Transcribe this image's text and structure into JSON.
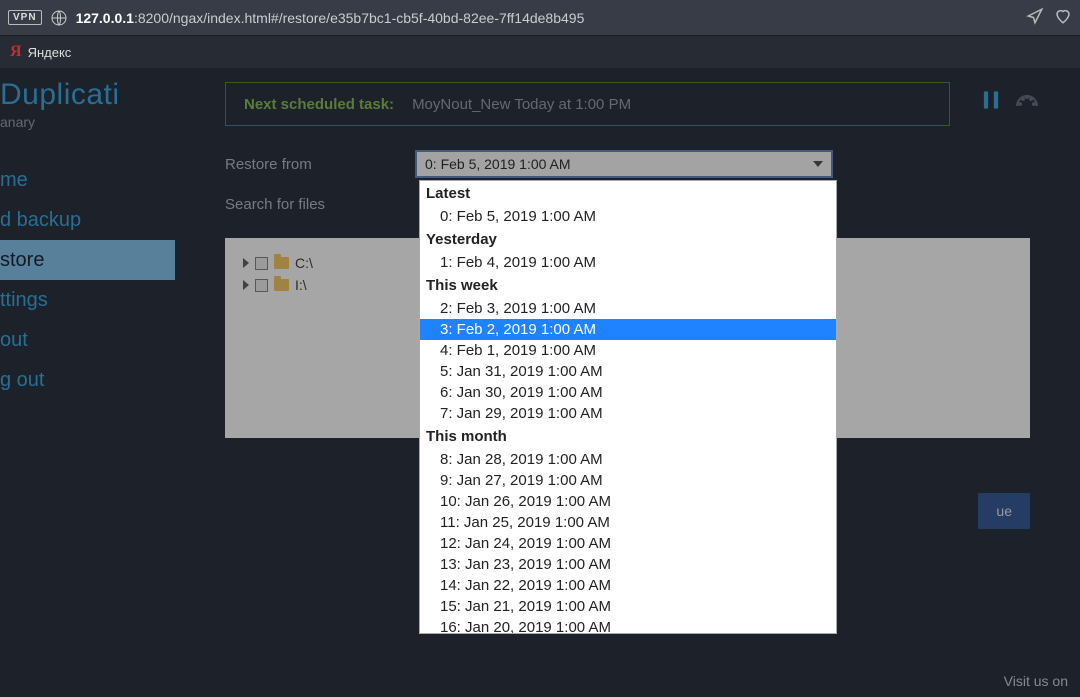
{
  "browser": {
    "vpn_badge": "VPN",
    "host": "127.0.0.1",
    "port_path": ":8200/ngax/index.html#/restore/e35b7bc1-cb5f-40bd-82ee-7ff14de8b495"
  },
  "yandex": {
    "label": "Яндекс"
  },
  "brand": {
    "title": "Duplicati",
    "subtitle": "anary"
  },
  "nav": {
    "home": "me",
    "add_backup": "d backup",
    "restore": "store",
    "settings": "ttings",
    "about": "out",
    "logout": "g out"
  },
  "task": {
    "label": "Next scheduled task:",
    "value": "MoyNout_New Today at 1:00 PM"
  },
  "form": {
    "restore_from": "Restore from",
    "search_label": "Search for files",
    "selected_version": "0: Feb 5, 2019 1:00 AM"
  },
  "tree": {
    "c": "C:\\",
    "i": "I:\\"
  },
  "buttons": {
    "continue": "ue"
  },
  "footer": {
    "visit": "Visit us on"
  },
  "dropdown": {
    "groups": [
      {
        "label": "Latest",
        "items": [
          "0: Feb 5, 2019 1:00 AM"
        ]
      },
      {
        "label": "Yesterday",
        "items": [
          "1: Feb 4, 2019 1:00 AM"
        ]
      },
      {
        "label": "This week",
        "items": [
          "2: Feb 3, 2019 1:00 AM",
          "3: Feb 2, 2019 1:00 AM",
          "4: Feb 1, 2019 1:00 AM",
          "5: Jan 31, 2019 1:00 AM",
          "6: Jan 30, 2019 1:00 AM",
          "7: Jan 29, 2019 1:00 AM"
        ]
      },
      {
        "label": "This month",
        "items": [
          "8: Jan 28, 2019 1:00 AM",
          "9: Jan 27, 2019 1:00 AM",
          "10: Jan 26, 2019 1:00 AM",
          "11: Jan 25, 2019 1:00 AM",
          "12: Jan 24, 2019 1:00 AM",
          "13: Jan 23, 2019 1:00 AM",
          "14: Jan 22, 2019 1:00 AM",
          "15: Jan 21, 2019 1:00 AM",
          "16: Jan 20, 2019 1:00 AM"
        ]
      }
    ],
    "highlighted": "3: Feb 2, 2019 1:00 AM"
  }
}
